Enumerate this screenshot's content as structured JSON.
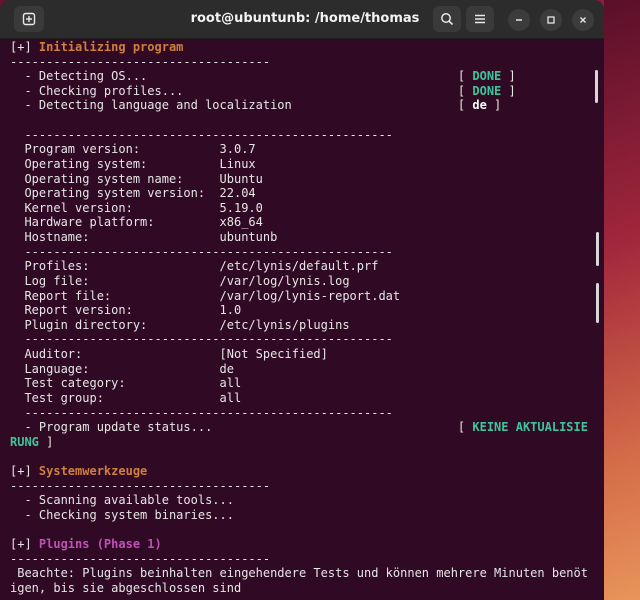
{
  "window": {
    "title": "root@ubuntunb: /home/thomas"
  },
  "icons": {
    "new_tab": "new-tab-icon",
    "search": "search-icon",
    "menu": "hamburger-menu-icon",
    "minimize": "minimize-icon",
    "maximize": "maximize-icon",
    "close": "close-icon"
  },
  "colors": {
    "terminal_bg": "#300a24",
    "section_header": "#cf7f3e",
    "plugin_header": "#c050b8",
    "status_ok": "#3ec49b",
    "text": "#e6e6e6"
  },
  "terminal": {
    "lines": [
      {
        "parts": [
          {
            "t": "[+] "
          },
          {
            "t": "Initializing program",
            "c": "hdr"
          }
        ]
      },
      {
        "parts": [
          {
            "t": "------------------------------------"
          }
        ]
      },
      {
        "parts": [
          {
            "t": "  - Detecting OS...                                           [ "
          },
          {
            "t": "DONE",
            "c": "ok"
          },
          {
            "t": " ]"
          }
        ]
      },
      {
        "parts": [
          {
            "t": "  - Checking profiles...                                      [ "
          },
          {
            "t": "DONE",
            "c": "ok"
          },
          {
            "t": " ]"
          }
        ]
      },
      {
        "parts": [
          {
            "t": "  - Detecting language and localization                       [ "
          },
          {
            "t": "de",
            "c": "de"
          },
          {
            "t": " ]"
          }
        ]
      },
      {
        "parts": [
          {
            "t": ""
          }
        ]
      },
      {
        "parts": [
          {
            "t": "  ---------------------------------------------------"
          }
        ]
      },
      {
        "parts": [
          {
            "t": "  Program version:           3.0.7"
          }
        ]
      },
      {
        "parts": [
          {
            "t": "  Operating system:          Linux"
          }
        ]
      },
      {
        "parts": [
          {
            "t": "  Operating system name:     Ubuntu"
          }
        ]
      },
      {
        "parts": [
          {
            "t": "  Operating system version:  22.04"
          }
        ]
      },
      {
        "parts": [
          {
            "t": "  Kernel version:            5.19.0"
          }
        ]
      },
      {
        "parts": [
          {
            "t": "  Hardware platform:         x86_64"
          }
        ]
      },
      {
        "parts": [
          {
            "t": "  Hostname:                  ubuntunb"
          }
        ]
      },
      {
        "parts": [
          {
            "t": "  ---------------------------------------------------"
          }
        ]
      },
      {
        "parts": [
          {
            "t": "  Profiles:                  /etc/lynis/default.prf"
          }
        ]
      },
      {
        "parts": [
          {
            "t": "  Log file:                  /var/log/lynis.log"
          }
        ]
      },
      {
        "parts": [
          {
            "t": "  Report file:               /var/log/lynis-report.dat"
          }
        ]
      },
      {
        "parts": [
          {
            "t": "  Report version:            1.0"
          }
        ]
      },
      {
        "parts": [
          {
            "t": "  Plugin directory:          /etc/lynis/plugins"
          }
        ]
      },
      {
        "parts": [
          {
            "t": "  ---------------------------------------------------"
          }
        ]
      },
      {
        "parts": [
          {
            "t": "  Auditor:                   [Not Specified]"
          }
        ]
      },
      {
        "parts": [
          {
            "t": "  Language:                  de"
          }
        ]
      },
      {
        "parts": [
          {
            "t": "  Test category:             all"
          }
        ]
      },
      {
        "parts": [
          {
            "t": "  Test group:                all"
          }
        ]
      },
      {
        "parts": [
          {
            "t": "  ---------------------------------------------------"
          }
        ]
      },
      {
        "parts": [
          {
            "t": "  - Program update status...                                  [ "
          },
          {
            "t": "KEINE AKTUALISIE",
            "c": "ok"
          }
        ]
      },
      {
        "parts": [
          {
            "t": "RUNG",
            "c": "ok"
          },
          {
            "t": " ]"
          }
        ]
      },
      {
        "parts": [
          {
            "t": ""
          }
        ]
      },
      {
        "parts": [
          {
            "t": "[+] "
          },
          {
            "t": "Systemwerkzeuge",
            "c": "hdr"
          }
        ]
      },
      {
        "parts": [
          {
            "t": "------------------------------------"
          }
        ]
      },
      {
        "parts": [
          {
            "t": "  - Scanning available tools..."
          }
        ]
      },
      {
        "parts": [
          {
            "t": "  - Checking system binaries..."
          }
        ]
      },
      {
        "parts": [
          {
            "t": ""
          }
        ]
      },
      {
        "parts": [
          {
            "t": "[+] "
          },
          {
            "t": "Plugins (Phase 1)",
            "c": "plug"
          }
        ]
      },
      {
        "parts": [
          {
            "t": "------------------------------------"
          }
        ]
      },
      {
        "parts": [
          {
            "t": " Beachte: Plugins beinhalten eingehendere Tests und können mehrere Minuten benöt"
          }
        ]
      },
      {
        "parts": [
          {
            "t": "igen, bis sie abgeschlossen sind"
          }
        ]
      }
    ]
  }
}
